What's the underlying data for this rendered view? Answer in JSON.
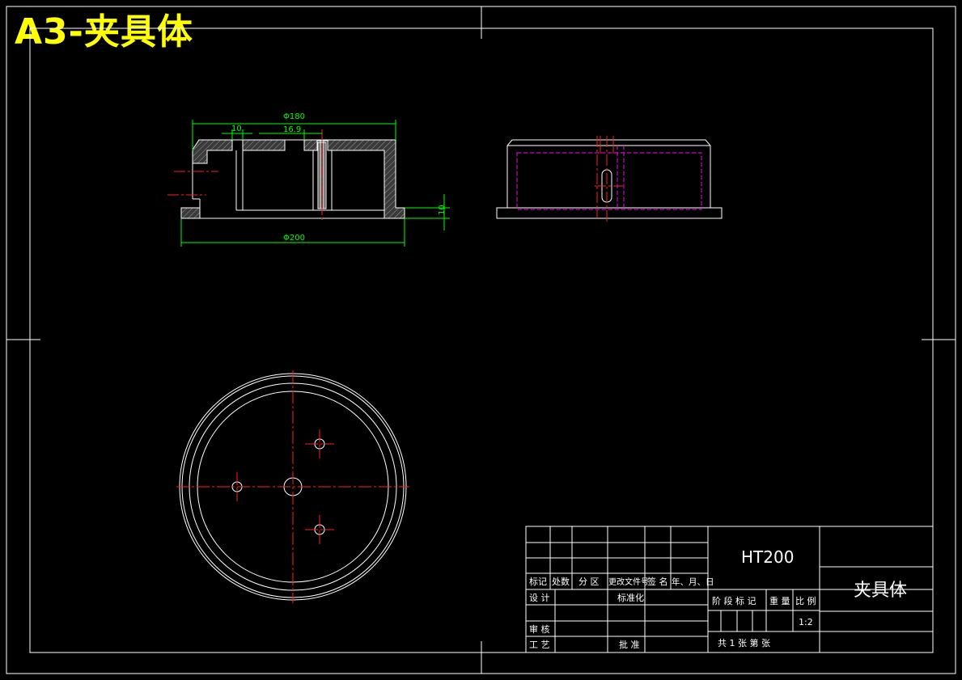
{
  "sheet_title": "A3-夹具体",
  "dimensions": {
    "top_diameter": "Φ180",
    "slot_width": "10",
    "offset": "16.9",
    "bottom_diameter": "Φ200",
    "flange_height": "10"
  },
  "title_block": {
    "material": "HT200",
    "part_name": "夹具体",
    "headers": [
      "标记",
      "处数",
      "分 区",
      "更改文件号",
      "签 名",
      "年、月、日"
    ],
    "design": "设 计",
    "standardization": "标准化",
    "review": "审 核",
    "process": "工 艺",
    "approve": "批 准",
    "stage_mark": "阶 段 标 记",
    "weight": "重 量",
    "scale_label": "比 例",
    "scale_value": "1:2",
    "sheets": "共 1 张 第 张"
  },
  "colors": {
    "background": "#000000",
    "outline": "#ffffff",
    "dimension": "#00ff00",
    "centerline": "#ff0000",
    "hidden": "#ff00ff",
    "hatch": "#7f7f7f",
    "title": "#ffff00"
  }
}
